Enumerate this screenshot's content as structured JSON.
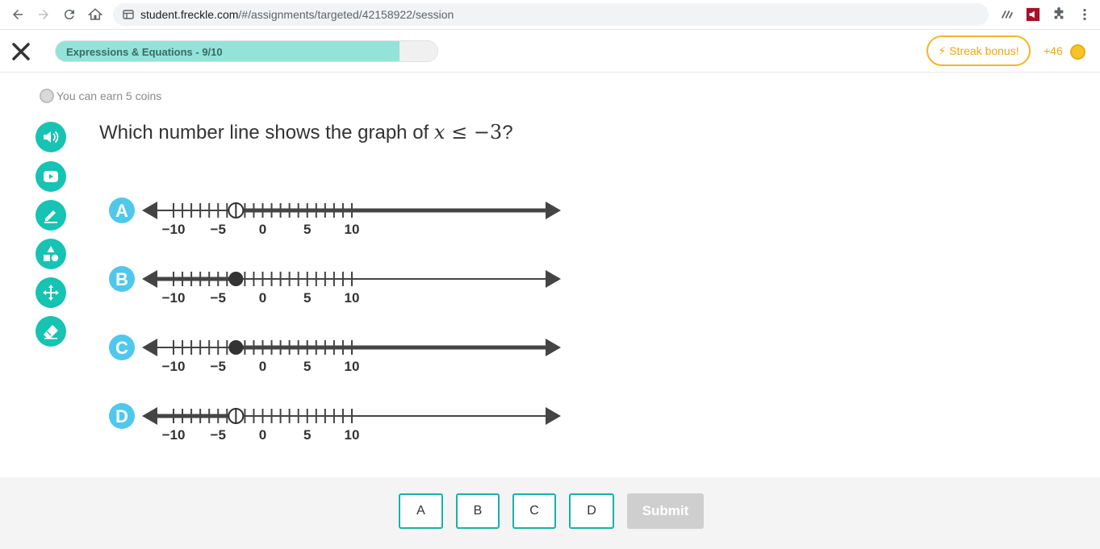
{
  "browser": {
    "url_host": "student.freckle.com",
    "url_path": "/#/assignments/targeted/42158922/session"
  },
  "header": {
    "progress_label": "Expressions & Equations - 9/10",
    "progress_fraction": 0.9,
    "streak_label": "Streak bonus!",
    "coin_count": "+46"
  },
  "content": {
    "earn_text": "You can earn 5 coins",
    "question_prefix": "Which number line shows the graph of ",
    "question_math_var": "x",
    "question_math_rel": " ≤ ",
    "question_math_val": "−3",
    "question_suffix": "?"
  },
  "tools": [
    {
      "name": "read-aloud-icon"
    },
    {
      "name": "video-icon"
    },
    {
      "name": "pencil-icon"
    },
    {
      "name": "shapes-icon"
    },
    {
      "name": "move-icon"
    },
    {
      "name": "eraser-icon"
    }
  ],
  "number_lines": {
    "tick_labels": [
      "−10",
      "−5",
      "0",
      "5",
      "10"
    ],
    "options": [
      {
        "letter": "A",
        "point": -3,
        "closed": false,
        "direction": "right"
      },
      {
        "letter": "B",
        "point": -3,
        "closed": true,
        "direction": "left"
      },
      {
        "letter": "C",
        "point": -3,
        "closed": true,
        "direction": "right"
      },
      {
        "letter": "D",
        "point": -3,
        "closed": false,
        "direction": "left"
      }
    ]
  },
  "answers": [
    "A",
    "B",
    "C",
    "D"
  ],
  "submit_label": "Submit",
  "colors": {
    "teal": "#17c3b2",
    "choice_blue": "#4fc8ec",
    "streak_orange": "#f3a512",
    "progress_fill": "#93e3d8"
  }
}
